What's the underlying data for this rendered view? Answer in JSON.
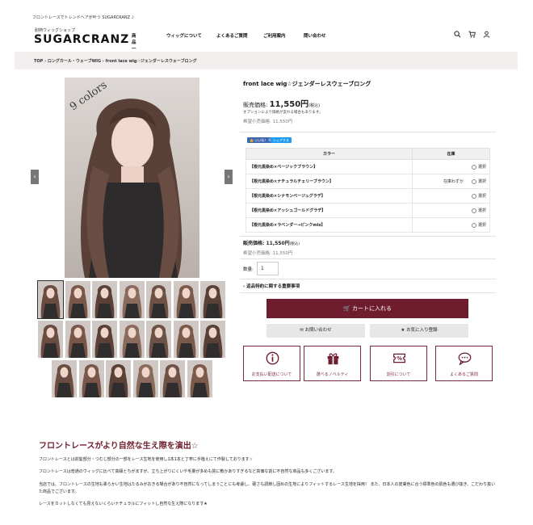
{
  "header": {
    "topline": "フロントレースでトレンドヘアが叶う SUGARCRANZ ♪",
    "brand_sub": "耐熱ウィッグショップ",
    "brand": "SUGARCRANZ",
    "nav": [
      "商品一覧",
      "ウィッグについて",
      "よくあるご質問",
      "ご利用案内",
      "問い合わせ"
    ],
    "icons": [
      "search-icon",
      "cart-icon",
      "user-icon"
    ]
  },
  "breadcrumb": "TOP › ロングカール・ウェーブWIG › front lace wig☆ジェンダーレスウェーブロング",
  "gallery": {
    "main_overlay": "9 colors",
    "prev": "‹",
    "next": "›",
    "thumb_count": 20
  },
  "product": {
    "title": "front lace wig☆ジェンダーレスウェーブロング",
    "price_label": "販売価格:",
    "price": "11,550円",
    "tax_note": "(税込)",
    "option_note": "オプションにより価格が変わる場合もあります。",
    "msrp": "希望小売価格: 11,550円",
    "like_btn": "👍 いいね！ 0",
    "share_btn": "シェアする",
    "table_headers": [
      "カラー",
      "在庫"
    ],
    "variants": [
      {
        "name": "【根元黒染め×ベージックブラウン】",
        "stock": "",
        "select": "選択"
      },
      {
        "name": "【根元黒染め×ナチュラルチェリーブラウン】",
        "stock": "在庫わずか",
        "select": "選択"
      },
      {
        "name": "【根元黒染め×シナモンベージュグラデ】",
        "stock": "",
        "select": "選択"
      },
      {
        "name": "【根元黒染め×アッシュゴールドグラデ】",
        "stock": "",
        "select": "選択"
      },
      {
        "name": "【根元黒染め×ラベンダー→ピンクmix】",
        "stock": "",
        "select": "選択"
      }
    ],
    "price2_label": "販売価格:",
    "price2": "11,550円",
    "price2_tax": "(税込)",
    "msrp2": "希望小売価格: 11,550円",
    "qty_label": "数量:",
    "qty_value": "1",
    "returns": "› 返品特約に関する重要事項",
    "cart_button": "🛒 カートに入れる",
    "contact_button": "✉ お問い合わせ",
    "favorite_button": "★ お気に入り登録",
    "cards": [
      {
        "icon": "info-icon",
        "label": "お支払い配送について"
      },
      {
        "icon": "gift-icon",
        "label": "選べるノベルティ"
      },
      {
        "icon": "discount-icon",
        "label": "割引について"
      },
      {
        "icon": "chat-icon",
        "label": "よくあるご質問"
      }
    ]
  },
  "section": {
    "title": "フロントレースがより自然な生え際を演出☆",
    "paragraphs": [
      "フロントレースとは前髪部分・つむじ部分の一部をレース生地を使用し1本1本と丁寧に手植えにて作製しております☆",
      "フロントレースは普通のウィッグに比べて高級とちがますが、立ち上がりにくいや毛量が多めも質に敷かありすぎるなど高価な割に不自然な商品も多くございます。",
      "当店では、フロントレースの生地も柔らかい生地はたるみがおきる場合があり不自然になってしまうことにも考慮し、硬さも調節し固めの生地によりフィットするレース生地を採用！ また、日本人の皮膚色に合う標準色の肌色も選び抜き、こだわり抜いた商品でございます。",
      "レースをカットしなくても見えないくらいナチュラルにフィットし自然な生え際になります★"
    ]
  },
  "colors": {
    "accent": "#6f1d2e",
    "breadcrumb_bg": "#f3efee",
    "social": "#4267b2"
  }
}
